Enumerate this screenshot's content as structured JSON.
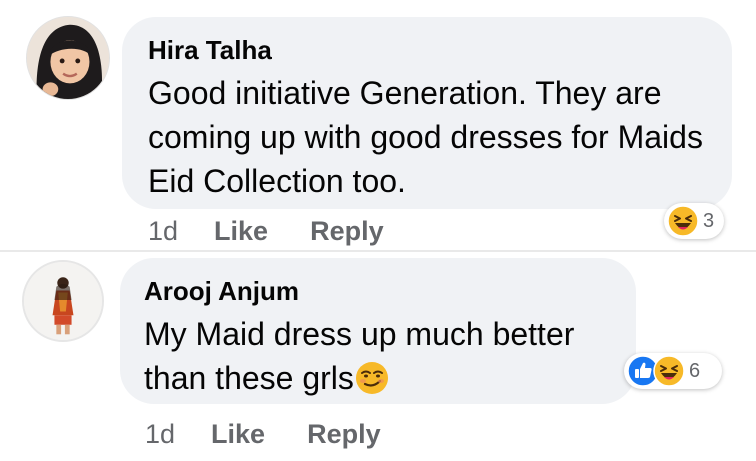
{
  "comments": [
    {
      "author": "Hira Talha",
      "text": "Good initiative Generation. They are coming up with good dresses for Maids Eid Collection too.",
      "time": "1d",
      "like_label": "Like",
      "reply_label": "Reply",
      "reactions": [
        "haha"
      ],
      "reaction_count": "3"
    },
    {
      "author": "Arooj Anjum",
      "text": "My Maid dress up much better than these grls",
      "inline_emoji": "smirk-emoji",
      "time": "1d",
      "like_label": "Like",
      "reply_label": "Reply",
      "reactions": [
        "like",
        "haha"
      ],
      "reaction_count": "6"
    }
  ],
  "colors": {
    "bubble": "#f0f2f5",
    "meta_text": "#65676b",
    "like_blue": "#1877f2",
    "haha_yellow": "#f7b928"
  }
}
